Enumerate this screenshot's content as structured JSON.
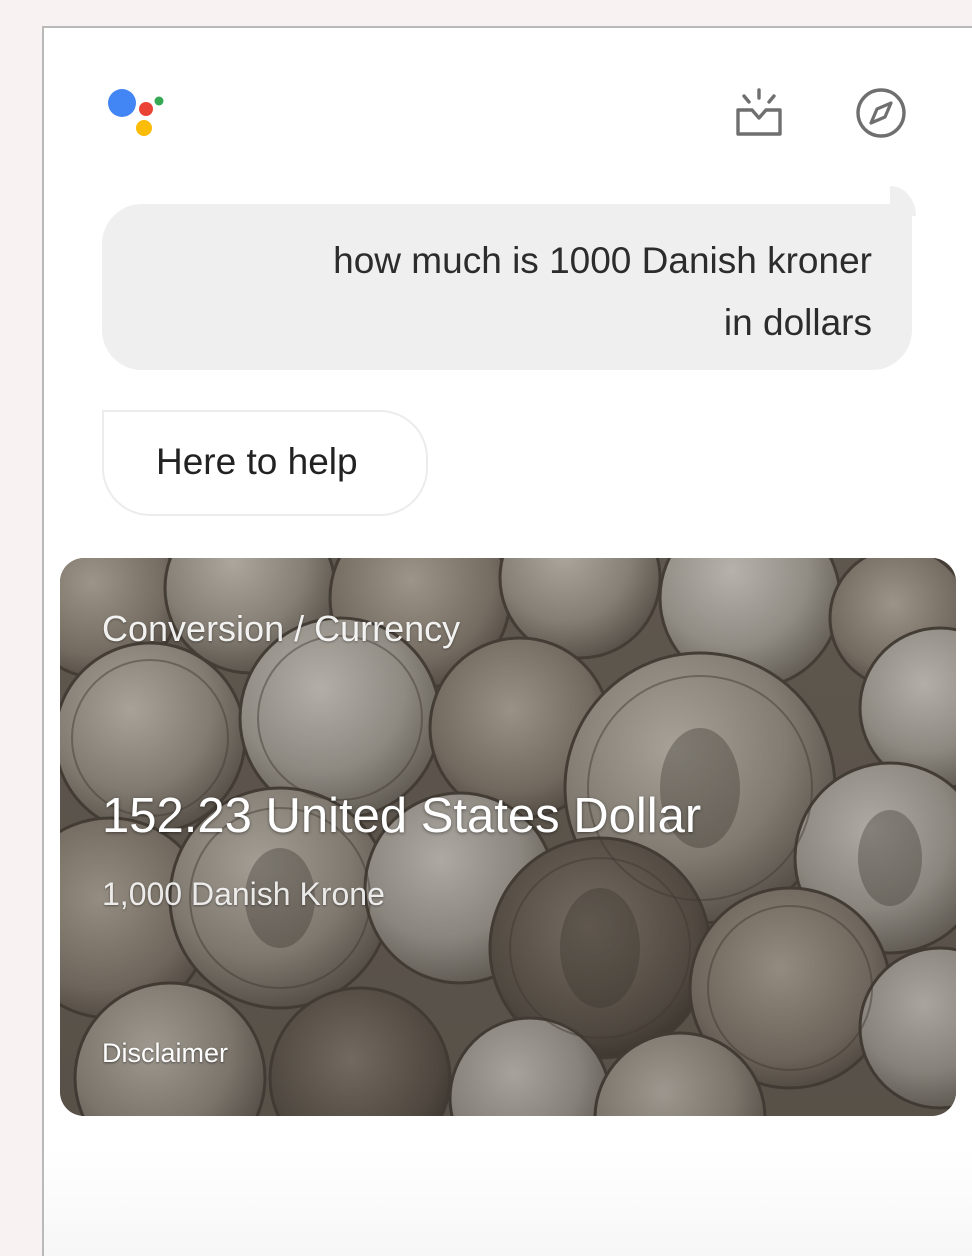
{
  "colors": {
    "logo_blue": "#4285f4",
    "logo_red": "#ea4335",
    "logo_yellow": "#fbbc05",
    "logo_green": "#34a853",
    "bubble_user_bg": "#efefef",
    "icon_gray": "#6f6f6f"
  },
  "header": {
    "logo_icon": "google-assistant-logo",
    "icons": [
      "whats-new-icon",
      "explore-compass-icon"
    ]
  },
  "conversation": {
    "user_query_line1": "how much is 1000 Danish kroner",
    "user_query_line2": "in dollars",
    "assistant_reply": "Here to help"
  },
  "card": {
    "category": "Conversion / Currency",
    "result": "152.23 United States Dollar",
    "source_amount": "1,000 Danish Krone",
    "disclaimer_label": "Disclaimer"
  }
}
